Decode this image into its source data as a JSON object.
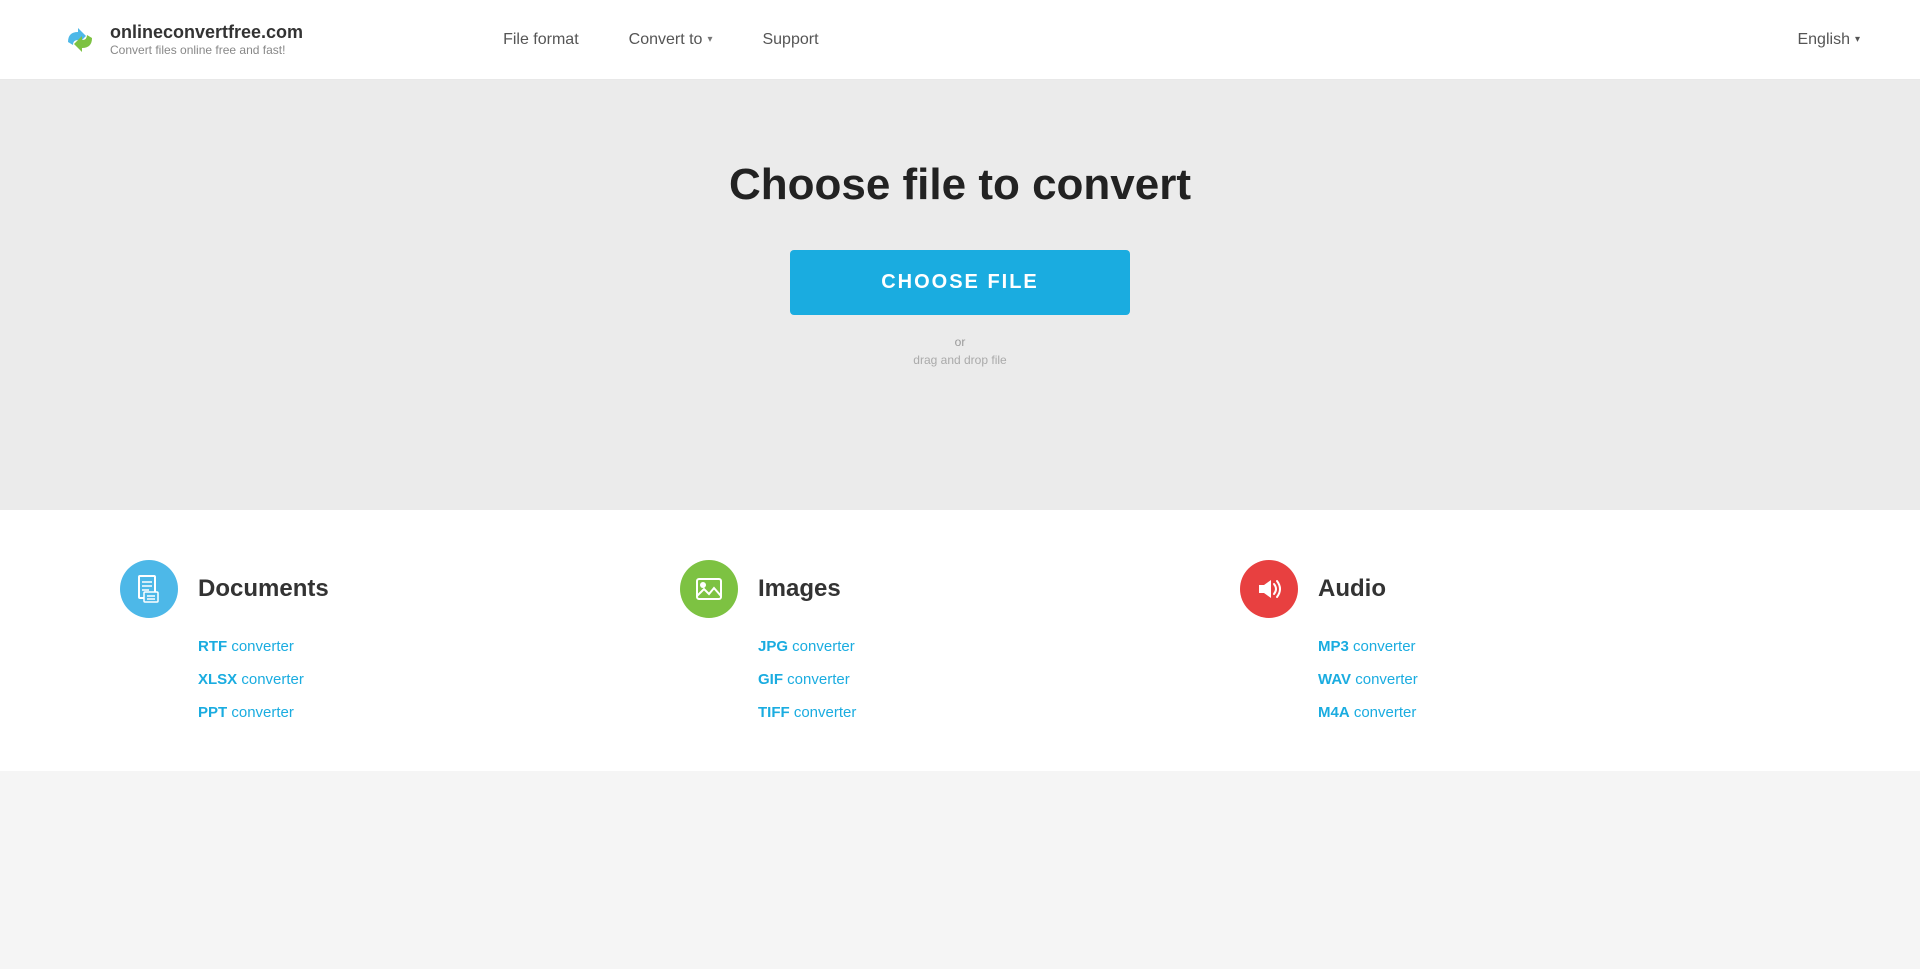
{
  "header": {
    "logo_title": "onlineconvertfree.com",
    "logo_subtitle": "Convert files online free and fast!",
    "nav": [
      {
        "label": "File format",
        "has_dropdown": false
      },
      {
        "label": "Convert to",
        "has_dropdown": true
      },
      {
        "label": "Support",
        "has_dropdown": false
      }
    ],
    "language": "English",
    "language_has_dropdown": true
  },
  "hero": {
    "title": "Choose file to convert",
    "choose_file_label": "CHOOSE FILE",
    "drag_or": "or",
    "drag_text": "drag and drop file"
  },
  "categories": [
    {
      "id": "documents",
      "title": "Documents",
      "icon_type": "document",
      "color": "blue",
      "links": [
        {
          "format": "RTF",
          "suffix": " converter"
        },
        {
          "format": "XLSX",
          "suffix": " converter"
        },
        {
          "format": "PPT",
          "suffix": " converter"
        }
      ]
    },
    {
      "id": "images",
      "title": "Images",
      "icon_type": "image",
      "color": "green",
      "links": [
        {
          "format": "JPG",
          "suffix": " converter"
        },
        {
          "format": "GIF",
          "suffix": " converter"
        },
        {
          "format": "TIFF",
          "suffix": " converter"
        }
      ]
    },
    {
      "id": "audio",
      "title": "Audio",
      "icon_type": "audio",
      "color": "red",
      "links": [
        {
          "format": "MP3",
          "suffix": " converter"
        },
        {
          "format": "WAV",
          "suffix": " converter"
        },
        {
          "format": "M4A",
          "suffix": " converter"
        }
      ]
    }
  ]
}
